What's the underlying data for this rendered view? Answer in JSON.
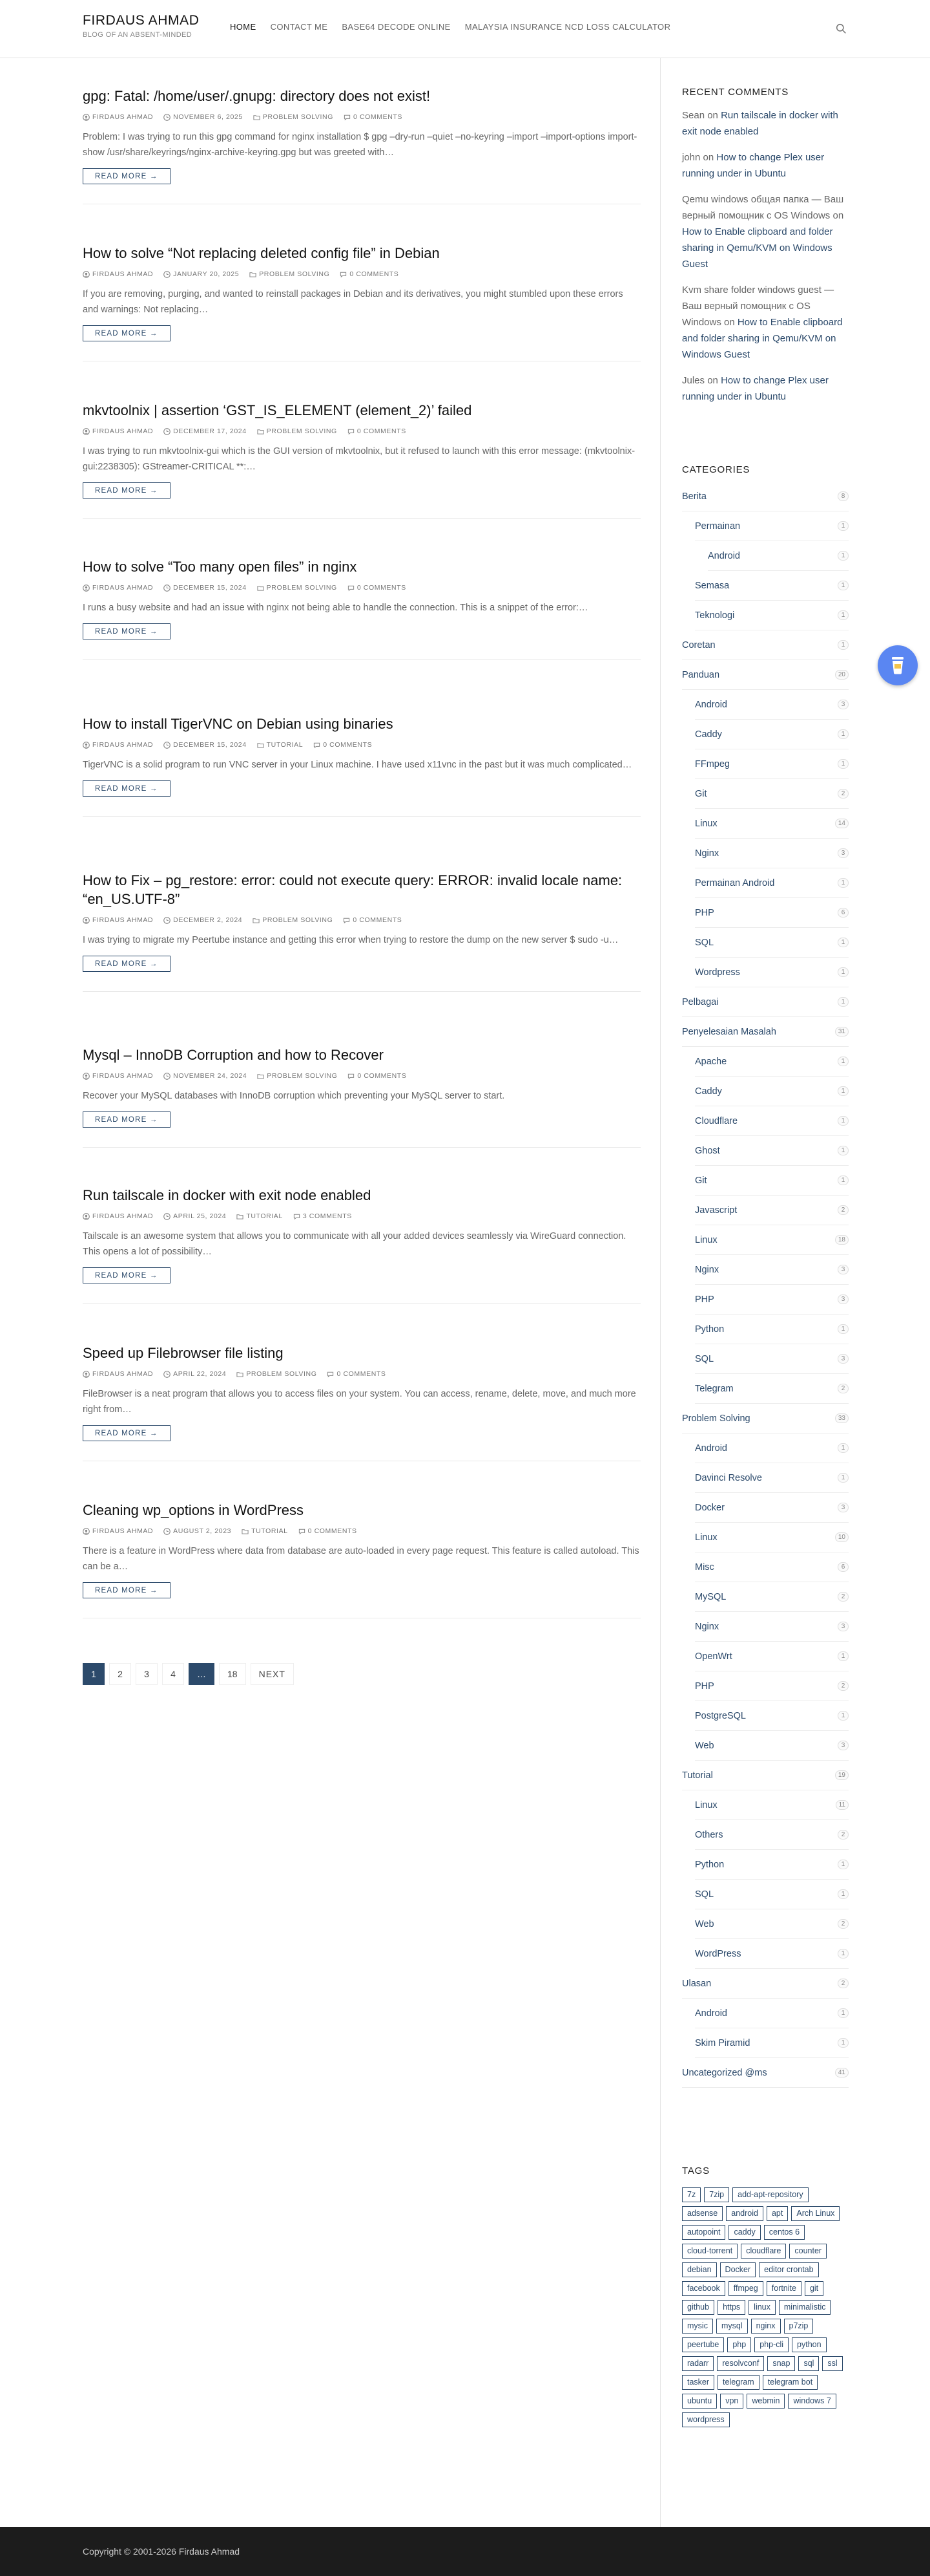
{
  "header": {
    "site_title": "FIRDAUS AHMAD",
    "tagline": "BLOG OF AN ABSENT-MINDED",
    "nav": [
      "HOME",
      "CONTACT ME",
      "BASE64 DECODE ONLINE",
      "MALAYSIA INSURANCE NCD LOSS CALCULATOR"
    ],
    "search_icon": "search-icon"
  },
  "posts": [
    {
      "title": "gpg: Fatal: /home/user/.gnupg: directory does not exist!",
      "author": "FIRDAUS AHMAD",
      "date": "NOVEMBER 6, 2025",
      "category": "PROBLEM SOLVING",
      "comments": "0 COMMENTS",
      "excerpt": "Problem: I was trying to run this gpg command for nginx installation $ gpg –dry-run –quiet –no-keyring –import –import-options import-show /usr/share/keyrings/nginx-archive-keyring.gpg but was greeted with…",
      "read_more": "READ MORE →"
    },
    {
      "title": "How to solve “Not replacing deleted config file” in Debian",
      "author": "FIRDAUS AHMAD",
      "date": "JANUARY 20, 2025",
      "category": "PROBLEM SOLVING",
      "comments": "0 COMMENTS",
      "excerpt": "If you are removing, purging, and wanted to reinstall packages in Debian and its derivatives, you might stumbled upon these errors and warnings: Not replacing…",
      "read_more": "READ MORE →"
    },
    {
      "title": "mkvtoolnix | assertion ‘GST_IS_ELEMENT (element_2)’ failed",
      "author": "FIRDAUS AHMAD",
      "date": "DECEMBER 17, 2024",
      "category": "PROBLEM SOLVING",
      "comments": "0 COMMENTS",
      "excerpt": "I was trying to run mkvtoolnix-gui which is the GUI version of mkvtoolnix, but it refused to launch with this error message: (mkvtoolnix-gui:2238305): GStreamer-CRITICAL **:…",
      "read_more": "READ MORE →"
    },
    {
      "title": "How to solve “Too many open files” in nginx",
      "author": "FIRDAUS AHMAD",
      "date": "DECEMBER 15, 2024",
      "category": "PROBLEM SOLVING",
      "comments": "0 COMMENTS",
      "excerpt": "I runs a busy website and had an issue with nginx not being able to handle the connection. This is a snippet of the error:…",
      "read_more": "READ MORE →"
    },
    {
      "title": "How to install TigerVNC on Debian using binaries",
      "author": "FIRDAUS AHMAD",
      "date": "DECEMBER 15, 2024",
      "category": "TUTORIAL",
      "comments": "0 COMMENTS",
      "excerpt": "TigerVNC is a solid program to run VNC server in your Linux machine. I have used x11vnc in the past but it was much complicated…",
      "read_more": "READ MORE →"
    },
    {
      "title": "How to Fix – pg_restore: error: could not execute query: ERROR:  invalid locale name: “en_US.UTF-8”",
      "author": "FIRDAUS AHMAD",
      "date": "DECEMBER 2, 2024",
      "category": "PROBLEM SOLVING",
      "comments": "0 COMMENTS",
      "excerpt": "I was trying to migrate my Peertube instance and getting this error when trying to restore the dump on the new server $ sudo -u…",
      "read_more": "READ MORE →"
    },
    {
      "title": "Mysql – InnoDB Corruption and how to Recover",
      "author": "FIRDAUS AHMAD",
      "date": "NOVEMBER 24, 2024",
      "category": "PROBLEM SOLVING",
      "comments": "0 COMMENTS",
      "excerpt": "Recover your MySQL databases with InnoDB corruption which preventing your MySQL server to start.",
      "read_more": "READ MORE →"
    },
    {
      "title": "Run tailscale in docker with exit node enabled",
      "author": "FIRDAUS AHMAD",
      "date": "APRIL 25, 2024",
      "category": "TUTORIAL",
      "comments": "3 COMMENTS",
      "excerpt": "Tailscale is an awesome system that allows you to communicate with all your added devices seamlessly via WireGuard connection. This opens a lot of possibility…",
      "read_more": "READ MORE →"
    },
    {
      "title": "Speed up Filebrowser file listing",
      "author": "FIRDAUS AHMAD",
      "date": "APRIL 22, 2024",
      "category": "PROBLEM SOLVING",
      "comments": "0 COMMENTS",
      "excerpt": "FileBrowser is a neat program that allows you to access files on your system. You can access, rename, delete, move, and much more right from…",
      "read_more": "READ MORE →"
    },
    {
      "title": "Cleaning wp_options in WordPress",
      "author": "FIRDAUS AHMAD",
      "date": "AUGUST 2, 2023",
      "category": "TUTORIAL",
      "comments": "0 COMMENTS",
      "excerpt": "There is a feature in WordPress where data from database are auto-loaded in every page request. This feature is called autoload. This can be a…",
      "read_more": "READ MORE →"
    }
  ],
  "pagination": {
    "pages": [
      "1",
      "2",
      "3",
      "4",
      "…",
      "18"
    ],
    "next": "NEXT"
  },
  "sidebar": {
    "recent_comments_title": "RECENT COMMENTS",
    "recent_comments": [
      {
        "author": "Sean",
        "on": "on",
        "post": "Run tailscale in docker with exit node enabled"
      },
      {
        "author": "john",
        "on": "on",
        "post": "How to change Plex user running under in Ubuntu"
      },
      {
        "author": "Qemu windows общая папка — Ваш верный помощник с OS Windows",
        "on": "on",
        "post": "How to Enable clipboard and folder sharing in Qemu/KVM on Windows Guest"
      },
      {
        "author": "Kvm share folder windows guest — Ваш верный помощник с OS Windows",
        "on": "on",
        "post": "How to Enable clipboard and folder sharing in Qemu/KVM on Windows Guest"
      },
      {
        "author": "Jules",
        "on": "on",
        "post": "How to change Plex user running under in Ubuntu"
      }
    ],
    "categories_title": "CATEGORIES",
    "categories": [
      {
        "name": "Berita",
        "count": "8",
        "level": 0
      },
      {
        "name": "Permainan",
        "count": "1",
        "level": 1
      },
      {
        "name": "Android",
        "count": "1",
        "level": 2
      },
      {
        "name": "Semasa",
        "count": "1",
        "level": 1
      },
      {
        "name": "Teknologi",
        "count": "1",
        "level": 1
      },
      {
        "name": "Coretan",
        "count": "1",
        "level": 0
      },
      {
        "name": "Panduan",
        "count": "20",
        "level": 0
      },
      {
        "name": "Android",
        "count": "3",
        "level": 1
      },
      {
        "name": "Caddy",
        "count": "1",
        "level": 1
      },
      {
        "name": "FFmpeg",
        "count": "1",
        "level": 1
      },
      {
        "name": "Git",
        "count": "2",
        "level": 1
      },
      {
        "name": "Linux",
        "count": "14",
        "level": 1
      },
      {
        "name": "Nginx",
        "count": "3",
        "level": 1
      },
      {
        "name": "Permainan Android",
        "count": "1",
        "level": 1
      },
      {
        "name": "PHP",
        "count": "6",
        "level": 1
      },
      {
        "name": "SQL",
        "count": "1",
        "level": 1
      },
      {
        "name": "Wordpress",
        "count": "1",
        "level": 1
      },
      {
        "name": "Pelbagai",
        "count": "1",
        "level": 0
      },
      {
        "name": "Penyelesaian Masalah",
        "count": "31",
        "level": 0
      },
      {
        "name": "Apache",
        "count": "1",
        "level": 1
      },
      {
        "name": "Caddy",
        "count": "1",
        "level": 1
      },
      {
        "name": "Cloudflare",
        "count": "1",
        "level": 1
      },
      {
        "name": "Ghost",
        "count": "1",
        "level": 1
      },
      {
        "name": "Git",
        "count": "1",
        "level": 1
      },
      {
        "name": "Javascript",
        "count": "2",
        "level": 1
      },
      {
        "name": "Linux",
        "count": "18",
        "level": 1
      },
      {
        "name": "Nginx",
        "count": "3",
        "level": 1
      },
      {
        "name": "PHP",
        "count": "3",
        "level": 1
      },
      {
        "name": "Python",
        "count": "1",
        "level": 1
      },
      {
        "name": "SQL",
        "count": "3",
        "level": 1
      },
      {
        "name": "Telegram",
        "count": "2",
        "level": 1
      },
      {
        "name": "Problem Solving",
        "count": "33",
        "level": 0
      },
      {
        "name": "Android",
        "count": "1",
        "level": 1
      },
      {
        "name": "Davinci Resolve",
        "count": "1",
        "level": 1
      },
      {
        "name": "Docker",
        "count": "3",
        "level": 1
      },
      {
        "name": "Linux",
        "count": "10",
        "level": 1
      },
      {
        "name": "Misc",
        "count": "6",
        "level": 1
      },
      {
        "name": "MySQL",
        "count": "2",
        "level": 1
      },
      {
        "name": "Nginx",
        "count": "3",
        "level": 1
      },
      {
        "name": "OpenWrt",
        "count": "1",
        "level": 1
      },
      {
        "name": "PHP",
        "count": "2",
        "level": 1
      },
      {
        "name": "PostgreSQL",
        "count": "1",
        "level": 1
      },
      {
        "name": "Web",
        "count": "3",
        "level": 1
      },
      {
        "name": "Tutorial",
        "count": "19",
        "level": 0
      },
      {
        "name": "Linux",
        "count": "11",
        "level": 1
      },
      {
        "name": "Others",
        "count": "2",
        "level": 1
      },
      {
        "name": "Python",
        "count": "1",
        "level": 1
      },
      {
        "name": "SQL",
        "count": "1",
        "level": 1
      },
      {
        "name": "Web",
        "count": "2",
        "level": 1
      },
      {
        "name": "WordPress",
        "count": "1",
        "level": 1
      },
      {
        "name": "Ulasan",
        "count": "2",
        "level": 0
      },
      {
        "name": "Android",
        "count": "1",
        "level": 1
      },
      {
        "name": "Skim Piramid",
        "count": "1",
        "level": 1
      },
      {
        "name": "Uncategorized @ms",
        "count": "41",
        "level": 0
      }
    ],
    "tags_title": "TAGS",
    "tags": [
      "7z",
      "7zip",
      "add-apt-repository",
      "adsense",
      "android",
      "apt",
      "Arch Linux",
      "autopoint",
      "caddy",
      "centos 6",
      "cloud-torrent",
      "cloudflare",
      "counter",
      "debian",
      "Docker",
      "editor crontab",
      "facebook",
      "ffmpeg",
      "fortnite",
      "git",
      "github",
      "https",
      "linux",
      "minimalistic",
      "mysic",
      "mysql",
      "nginx",
      "p7zip",
      "peertube",
      "php",
      "php-cli",
      "python",
      "radarr",
      "resolvconf",
      "snap",
      "sql",
      "ssl",
      "tasker",
      "telegram",
      "telegram bot",
      "ubuntu",
      "vpn",
      "webmin",
      "windows 7",
      "wordpress"
    ]
  },
  "footer": {
    "copyright": "Copyright © 2001-2026 Firdaus Ahmad"
  },
  "fab": {
    "icon": "coffee-cup-icon",
    "color": "#5a86f2"
  },
  "colors": {
    "accent": "#2c4a6b",
    "footer_bg": "#1c1c1c"
  }
}
